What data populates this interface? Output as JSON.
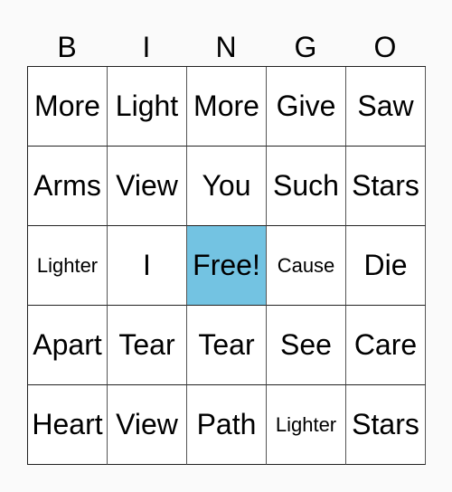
{
  "header": [
    "B",
    "I",
    "N",
    "G",
    "O"
  ],
  "free_color": "#73c3e2",
  "cells": [
    [
      "More",
      "Light",
      "More",
      "Give",
      "Saw"
    ],
    [
      "Arms",
      "View",
      "You",
      "Such",
      "Stars"
    ],
    [
      "Lighter",
      "I",
      "Free!",
      "Cause",
      "Die"
    ],
    [
      "Apart",
      "Tear",
      "Tear",
      "See",
      "Care"
    ],
    [
      "Heart",
      "View",
      "Path",
      "Lighter",
      "Stars"
    ]
  ]
}
